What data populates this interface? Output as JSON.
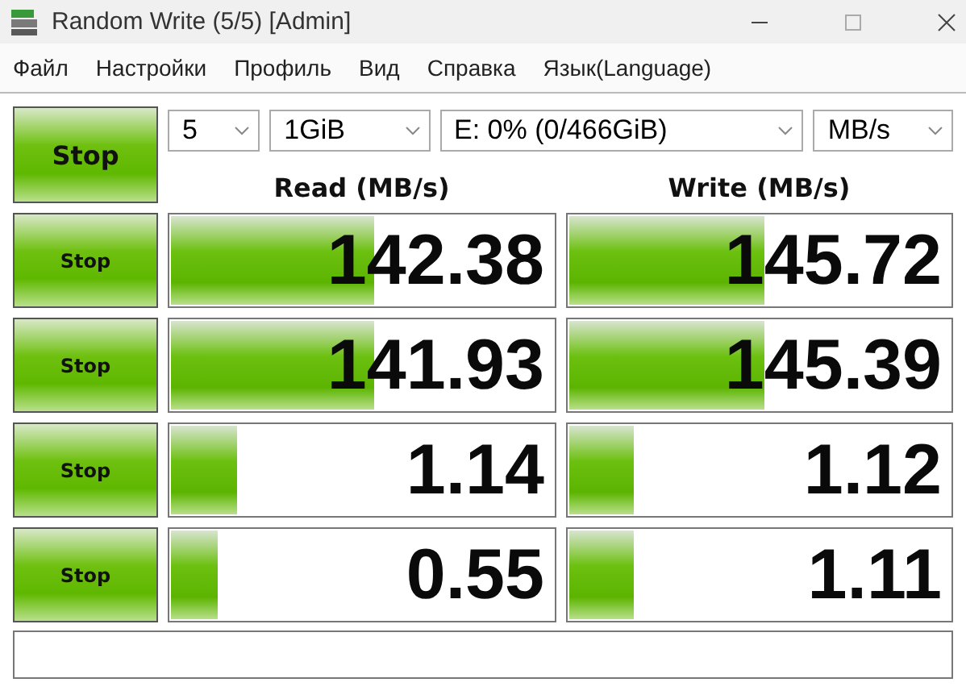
{
  "window": {
    "title": "Random Write (5/5) [Admin]"
  },
  "menu": [
    "Файл",
    "Настройки",
    "Профиль",
    "Вид",
    "Справка",
    "Язык(Language)"
  ],
  "main_button": "Stop",
  "selectors": [
    {
      "value": "5"
    },
    {
      "value": "1GiB"
    },
    {
      "value": "E: 0% (0/466GiB)"
    },
    {
      "value": "MB/s"
    }
  ],
  "columns": [
    "Read (MB/s)",
    "Write (MB/s)"
  ],
  "rows": [
    {
      "button": "Stop",
      "read": {
        "value": "142.38",
        "level": 0.53
      },
      "write": {
        "value": "145.72",
        "level": 0.51
      }
    },
    {
      "button": "Stop",
      "read": {
        "value": "141.93",
        "level": 0.53
      },
      "write": {
        "value": "145.39",
        "level": 0.51
      }
    },
    {
      "button": "Stop",
      "read": {
        "value": "1.14",
        "level": 0.17
      },
      "write": {
        "value": "1.12",
        "level": 0.17
      }
    },
    {
      "button": "Stop",
      "read": {
        "value": "0.55",
        "level": 0.12
      },
      "write": {
        "value": "1.11",
        "level": 0.17
      }
    }
  ]
}
